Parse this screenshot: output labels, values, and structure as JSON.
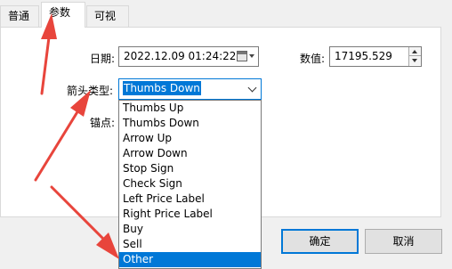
{
  "tabs": [
    "普通",
    "参数",
    "可视化"
  ],
  "active_tab": "参数",
  "date": {
    "label": "日期:",
    "value": "2022.12.09 01:24:22"
  },
  "value_field": {
    "label": "数值:",
    "value": "17195.529"
  },
  "arrow_type": {
    "label": "箭头类型:",
    "selected": "Thumbs Down"
  },
  "anchor": {
    "label": "锚点:"
  },
  "dropdown": {
    "options": [
      "Thumbs Up",
      "Thumbs Down",
      "Arrow Up",
      "Arrow Down",
      "Stop Sign",
      "Check Sign",
      "Left Price Label",
      "Right Price Label",
      "Buy",
      "Sell",
      "Other"
    ],
    "highlighted": "Other"
  },
  "buttons": {
    "ok": "确定",
    "cancel": "取消"
  },
  "colors": {
    "accent": "#0078d7",
    "annotation": "#e8453c"
  }
}
